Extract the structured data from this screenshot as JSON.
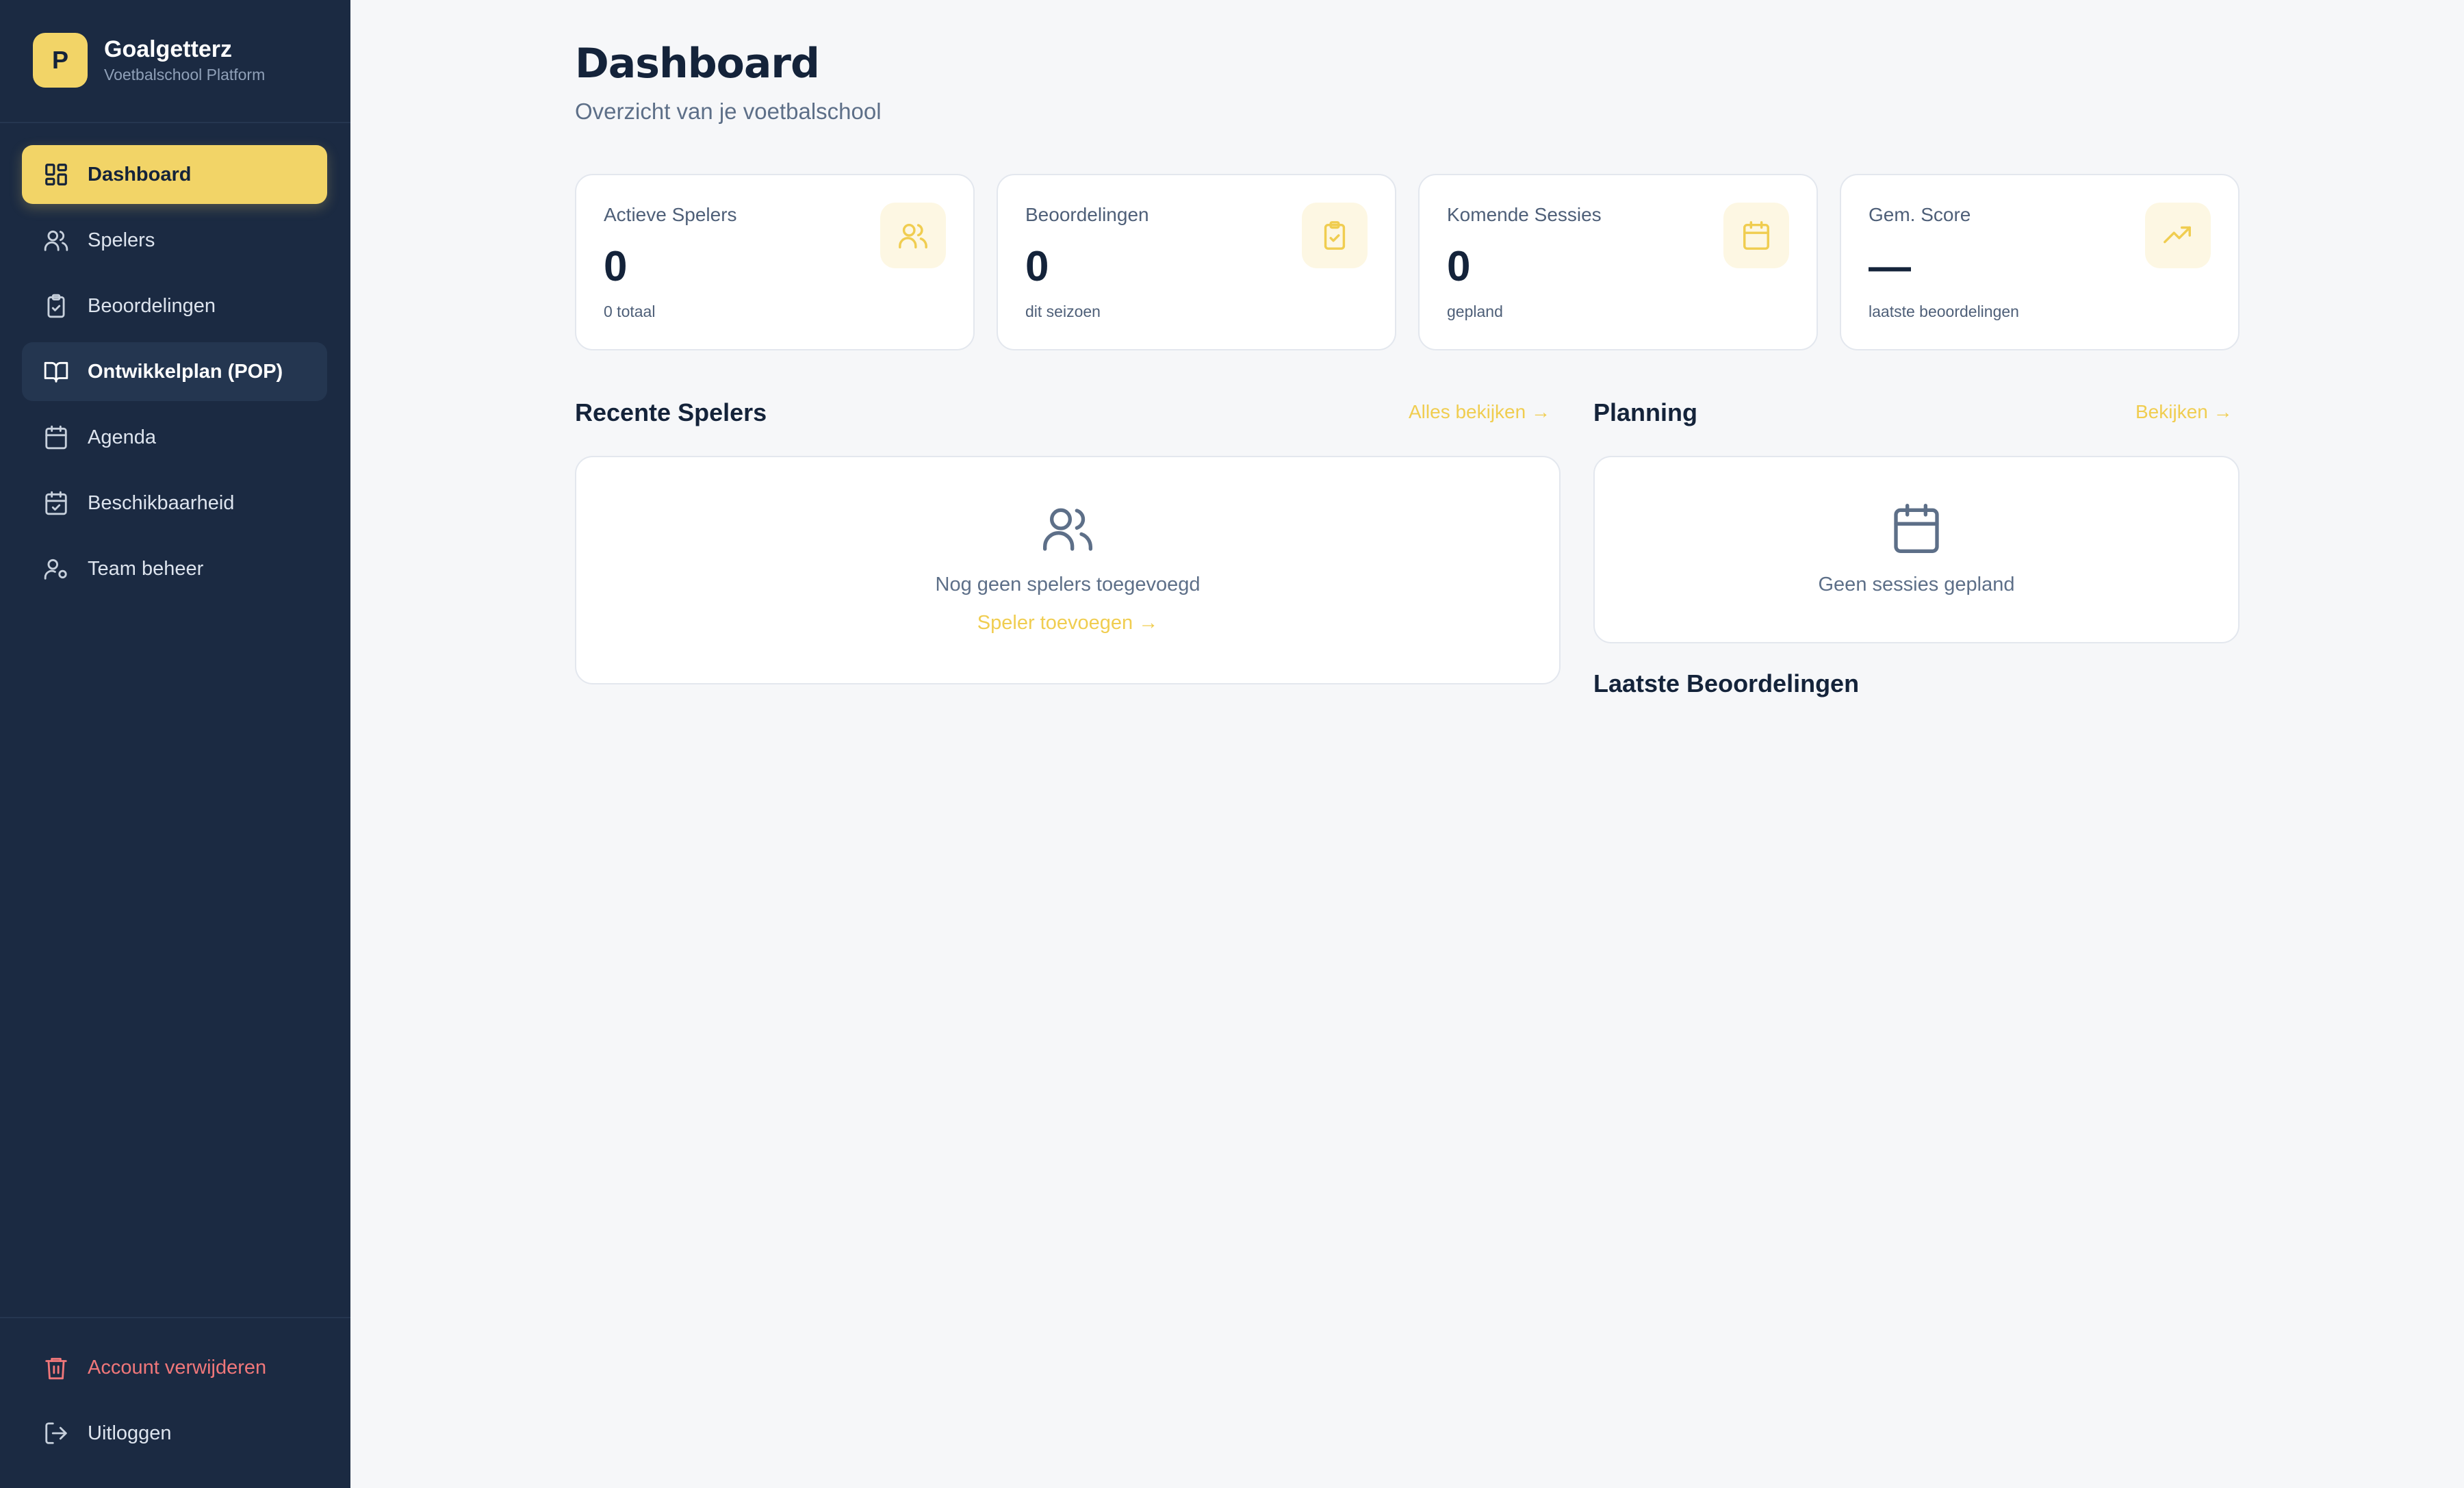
{
  "brand": {
    "logo_letter": "P",
    "name": "Goalgetterz",
    "subtitle": "Voetbalschool Platform"
  },
  "nav": {
    "items": [
      {
        "label": "Dashboard",
        "icon": "dashboard-grid-icon",
        "state": "active"
      },
      {
        "label": "Spelers",
        "icon": "users-icon"
      },
      {
        "label": "Beoordelingen",
        "icon": "clipboard-check-icon"
      },
      {
        "label": "Ontwikkelplan (POP)",
        "icon": "book-open-icon",
        "state": "hover"
      },
      {
        "label": "Agenda",
        "icon": "calendar-icon"
      },
      {
        "label": "Beschikbaarheid",
        "icon": "calendar-check-icon"
      },
      {
        "label": "Team beheer",
        "icon": "user-cog-icon"
      }
    ],
    "bottom": [
      {
        "label": "Account verwijderen",
        "icon": "trash-icon"
      },
      {
        "label": "Uitloggen",
        "icon": "logout-icon"
      }
    ]
  },
  "header": {
    "title": "Dashboard",
    "subtitle": "Overzicht van je voetbalschool"
  },
  "stats": [
    {
      "label": "Actieve Spelers",
      "value": "0",
      "note": "0 totaal",
      "icon": "users-icon"
    },
    {
      "label": "Beoordelingen",
      "value": "0",
      "note": "dit seizoen",
      "icon": "clipboard-check-icon"
    },
    {
      "label": "Komende Sessies",
      "value": "0",
      "note": "gepland",
      "icon": "calendar-icon"
    },
    {
      "label": "Gem. Score",
      "value": "—",
      "note": "laatste beoordelingen",
      "icon": "trending-up-icon"
    }
  ],
  "recent_players": {
    "title": "Recente Spelers",
    "link": "Alles bekijken →",
    "empty_text": "Nog geen spelers toegevoegd",
    "empty_action": "Speler toevoegen →"
  },
  "planning": {
    "title": "Planning",
    "link": "Bekijken →",
    "empty_text": "Geen sessies gepland"
  },
  "latest_reviews": {
    "title": "Laatste Beoordelingen"
  },
  "colors": {
    "sidebar": "#1b2a42",
    "accent": "#f2d467",
    "danger": "#f0777a",
    "background": "#f6f7f9"
  }
}
